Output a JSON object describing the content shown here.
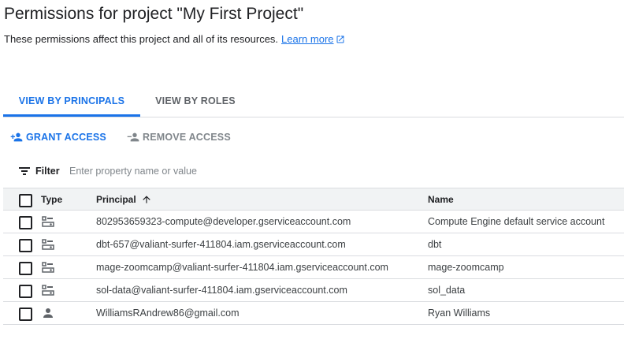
{
  "header": {
    "title": "Permissions for project \"My First Project\"",
    "description": "These permissions affect this project and all of its resources.",
    "learn_more": "Learn more"
  },
  "tabs": [
    {
      "label": "VIEW BY PRINCIPALS",
      "active": true
    },
    {
      "label": "VIEW BY ROLES",
      "active": false
    }
  ],
  "actions": {
    "grant": "GRANT ACCESS",
    "remove": "REMOVE ACCESS"
  },
  "filter": {
    "label": "Filter",
    "placeholder": "Enter property name or value"
  },
  "table": {
    "columns": {
      "type": "Type",
      "principal": "Principal",
      "name": "Name"
    },
    "sort": "principal-ascending",
    "rows": [
      {
        "type": "service-account-icon",
        "principal": "802953659323-compute@developer.gserviceaccount.com",
        "name": "Compute Engine default service account"
      },
      {
        "type": "service-account-icon",
        "principal": "dbt-657@valiant-surfer-411804.iam.gserviceaccount.com",
        "name": "dbt"
      },
      {
        "type": "service-account-icon",
        "principal": "mage-zoomcamp@valiant-surfer-411804.iam.gserviceaccount.com",
        "name": "mage-zoomcamp"
      },
      {
        "type": "service-account-icon",
        "principal": "sol-data@valiant-surfer-411804.iam.gserviceaccount.com",
        "name": "sol_data"
      },
      {
        "type": "person-icon",
        "principal": "WilliamsRAndrew86@gmail.com",
        "name": "Ryan Williams"
      }
    ]
  },
  "colors": {
    "accent": "#1a73e8",
    "text": "#202124",
    "muted": "#5f6368",
    "border": "#dadce0",
    "header_bg": "#f1f3f4"
  }
}
